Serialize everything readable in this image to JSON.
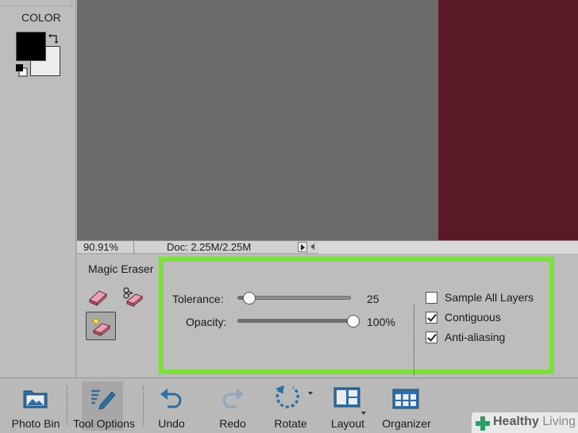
{
  "toolbox": {
    "color_label": "COLOR"
  },
  "status_bar": {
    "zoom": "90.91%",
    "doc_size": "Doc: 2.25M/2.25M"
  },
  "tool_options": {
    "tool_name": "Magic Eraser",
    "tolerance_label": "Tolerance:",
    "tolerance_value": "25",
    "tolerance_fraction": 0.1,
    "opacity_label": "Opacity:",
    "opacity_value": "100%",
    "opacity_fraction": 1.0,
    "sample_all_layers": {
      "label": "Sample All Layers",
      "checked": false
    },
    "contiguous": {
      "label": "Contiguous",
      "checked": true
    },
    "anti_aliasing": {
      "label": "Anti-aliasing",
      "checked": true
    }
  },
  "taskbar": {
    "photo_bin": "Photo Bin",
    "tool_options": "Tool Options",
    "undo": "Undo",
    "redo": "Redo",
    "rotate": "Rotate",
    "layout": "Layout",
    "organizer": "Organizer"
  },
  "watermark": {
    "brand_bold": "Healthy",
    "brand_light": "Living"
  },
  "colors": {
    "foreground": "#000000",
    "background": "#ededed",
    "highlight": "#7be03f",
    "image_fill": "#5b1a28",
    "accent_blue": "#2f6da3"
  },
  "icons": {
    "swap": "swap-colors-icon",
    "default_colors": "default-colors-icon",
    "photo_bin": "photo-bin-icon",
    "tool_options": "tool-options-icon",
    "undo": "undo-icon",
    "redo": "redo-icon",
    "rotate": "rotate-icon",
    "layout": "layout-icon",
    "organizer": "organizer-icon"
  }
}
